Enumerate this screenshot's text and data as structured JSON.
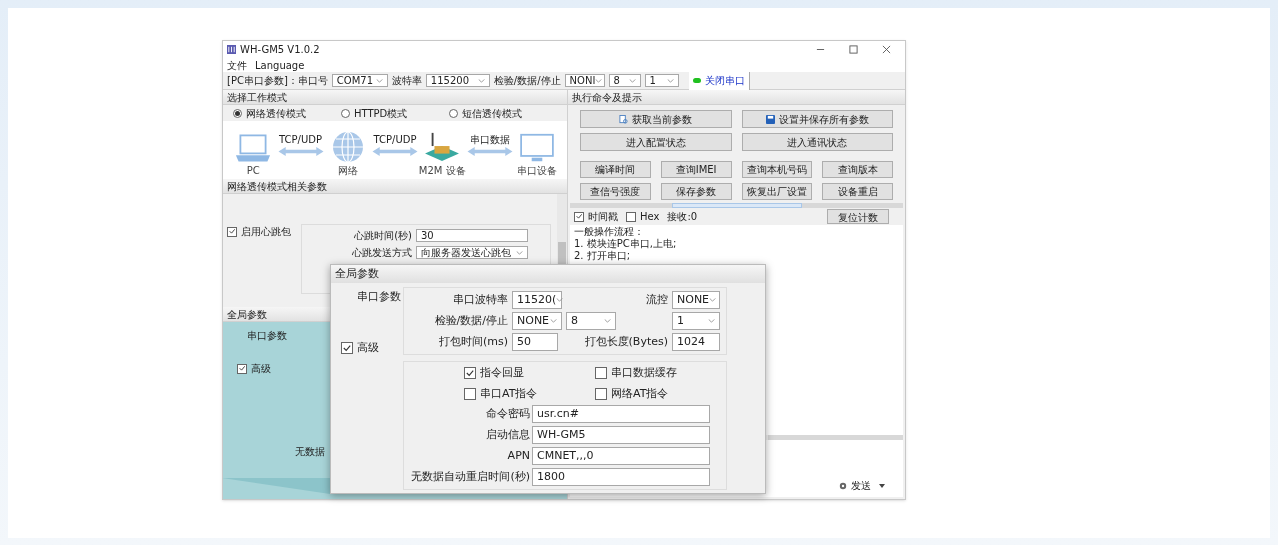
{
  "window": {
    "title": "WH-GM5 V1.0.2"
  },
  "menu": [
    "文件",
    "Language"
  ],
  "serial_bar": {
    "label": "[PC串口参数]：串口号",
    "port": "COM71",
    "baud_label": "波特率",
    "baud": "115200",
    "parity_label": "检验/数据/停止",
    "parity": "NONI",
    "data_bits": "8",
    "stop_bits": "1",
    "tab": {
      "label": "关闭串口",
      "on": true
    }
  },
  "mode_section": {
    "title": "选择工作模式",
    "modes": [
      {
        "label": "网络透传模式",
        "selected": true
      },
      {
        "label": "HTTPD模式",
        "selected": false
      },
      {
        "label": "短信透传模式",
        "selected": false
      }
    ],
    "nodes": [
      {
        "kind": "laptop",
        "label": "PC"
      },
      {
        "kind": "globe",
        "label": "网络"
      },
      {
        "kind": "device",
        "label": "M2M 设备"
      },
      {
        "kind": "monitor",
        "label": "串口设备"
      }
    ],
    "links": [
      "TCP/UDP",
      "TCP/UDP",
      "串口数据"
    ]
  },
  "net_section": {
    "title": "网络透传模式相关参数",
    "heartbeat": {
      "label": "启用心跳包",
      "checked": true
    },
    "fields": [
      {
        "kind": "text",
        "label": "心跳时间(秒)",
        "value": "30"
      },
      {
        "kind": "select",
        "label": "心跳发送方式",
        "value": "向服务器发送心跳包"
      }
    ]
  },
  "global_small": {
    "title": "全局参数",
    "serial_label": "串口参数",
    "advanced": {
      "label": "高级",
      "checked": true
    },
    "cut_label": "无数据"
  },
  "commands": {
    "title": "执行命令及提示",
    "wide_buttons": [
      {
        "kind": "read",
        "label": "获取当前参数"
      },
      {
        "kind": "save",
        "label": "设置并保存所有参数"
      },
      {
        "kind": "plain",
        "label": "进入配置状态"
      },
      {
        "kind": "plain",
        "label": "进入通讯状态"
      }
    ],
    "buttons": [
      "编译时间",
      "查询IMEI",
      "查询本机号码",
      "查询版本",
      "查信号强度",
      "保存参数",
      "恢复出厂设置",
      "设备重启"
    ]
  },
  "log": {
    "timestamp": {
      "label": "时间戳",
      "checked": true
    },
    "hex": {
      "label": "Hex",
      "checked": false
    },
    "rx": "接收:0",
    "reset": "复位计数",
    "lines": [
      "一般操作流程：",
      "1. 模块连PC串口,上电;",
      "2. 打开串口;"
    ]
  },
  "send": {
    "label": "发送"
  },
  "global_panel": {
    "title": "全局参数",
    "serial_label": "串口参数",
    "baud": {
      "label": "串口波特率",
      "value": "11520("
    },
    "flow": {
      "label": "流控",
      "value": "NONE"
    },
    "parity": {
      "label": "检验/数据/停止",
      "values": [
        "NONE",
        "8",
        "1"
      ]
    },
    "pack_time": {
      "label": "打包时间(ms)",
      "value": "50"
    },
    "pack_len": {
      "label": "打包长度(Bytes)",
      "value": "1024"
    },
    "advanced": {
      "label": "高级",
      "checked": true
    },
    "options": [
      {
        "label": "指令回显",
        "checked": true
      },
      {
        "label": "串口数据缓存",
        "checked": false
      },
      {
        "label": "串口AT指令",
        "checked": false
      },
      {
        "label": "网络AT指令",
        "checked": false
      }
    ],
    "fields": [
      {
        "label": "命令密码",
        "value": "usr.cn#"
      },
      {
        "label": "启动信息",
        "value": "WH-GM5"
      },
      {
        "label": "APN",
        "value": "CMNET,,,0"
      },
      {
        "label": "无数据自动重启时间(秒)",
        "value": "1800"
      }
    ]
  }
}
